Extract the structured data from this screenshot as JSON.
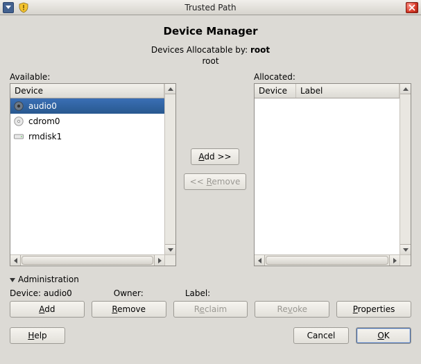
{
  "window": {
    "title": "Trusted Path"
  },
  "heading": "Device Manager",
  "subhead": {
    "prefix": "Devices Allocatable by: ",
    "user_bold": "root",
    "line2": "root"
  },
  "labels": {
    "available": "Available:",
    "allocated": "Allocated:"
  },
  "available": {
    "columns": [
      "Device"
    ],
    "items": [
      {
        "name": "audio0",
        "icon": "audio",
        "selected": true
      },
      {
        "name": "cdrom0",
        "icon": "disc",
        "selected": false
      },
      {
        "name": "rmdisk1",
        "icon": "drive",
        "selected": false
      }
    ]
  },
  "allocated": {
    "columns": [
      "Device",
      "Label"
    ],
    "items": []
  },
  "mid_buttons": {
    "add": "Add >>",
    "remove": "<< Remove"
  },
  "admin": {
    "title": "Administration",
    "device_label": "Device: ",
    "device_value": "audio0",
    "owner_label": "Owner:",
    "owner_value": "",
    "label_label": "Label:",
    "label_value": "",
    "buttons": {
      "add": "Add",
      "remove": "Remove",
      "reclaim": "Reclaim",
      "revoke": "Revoke",
      "properties": "Properties"
    }
  },
  "footer": {
    "help": "Help",
    "cancel": "Cancel",
    "ok": "OK"
  }
}
